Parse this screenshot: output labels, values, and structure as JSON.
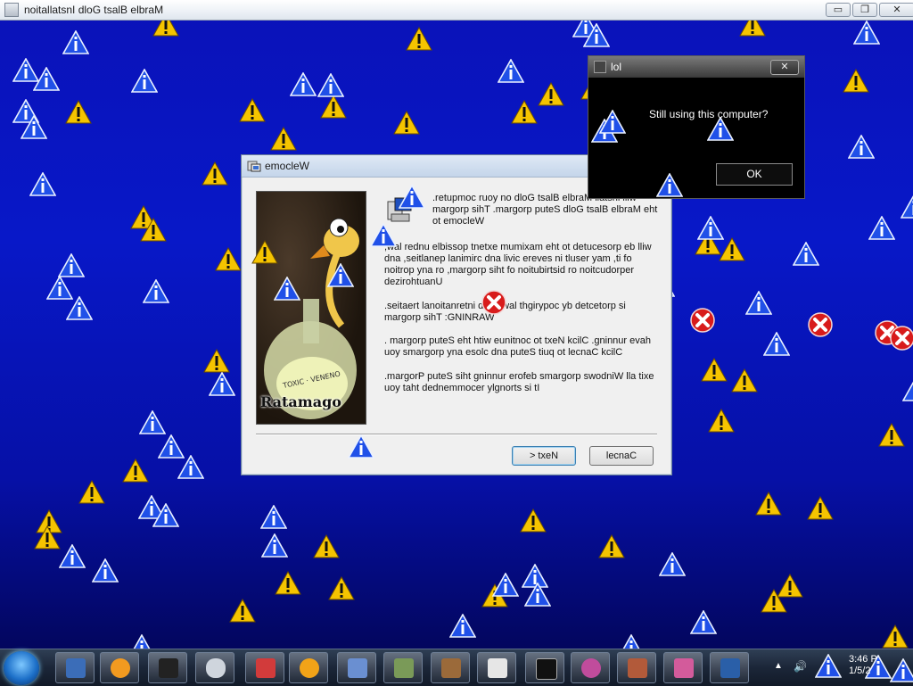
{
  "main_window": {
    "title": "noitallatsnI dloG tsalB elbraM",
    "minimize": "▭",
    "maximize": "❐",
    "close": "✕"
  },
  "wizard": {
    "title": "emocleW",
    "image_brand": "Ratamago",
    "paragraphs": [
      ".retupmoc ruoy no dloG tsalB elbraM llatsni lliw margorp sihT .margorp puteS dloG tsalB elbraM eht ot emocleW",
      ",wal rednu elbissop tnetxe mumixam eht ot detucesorp eb lliw dna ,seitlanep lanimirc dna livic ereves ni tluser yam ,ti fo noitrop yna ro ,margorp siht fo noitubirtsid ro noitcudorper dezirohtuanU",
      ".seitaert lanoitanretni dna swal thgirypoc yb detcetorp si margorp sihT :GNINRAW",
      ". margorp puteS eht htiw eunitnoc ot txeN kcilC .gninnur evah uoy smargorp yna esolc dna puteS tiuq ot lecnaC kcilC",
      ".margorP puteS siht gninnur erofeb smargorp swodniW lla tixe uoy taht dednemmocer ylgnorts si tI"
    ],
    "next_button": "> txeN",
    "cancel_button": "lecnaC"
  },
  "lol_dialog": {
    "title": "lol",
    "message": "Still using this computer?",
    "ok_button": "OK",
    "close": "✕"
  },
  "taskbar": {
    "clock_time": "3:46 P",
    "clock_date": "1/5/2",
    "apps": [
      "windows-explorer",
      "media-player",
      "smartphone-app",
      "mouse-app",
      "paint-app",
      "sun-app",
      "setup-app",
      "setup-app-2",
      "calculator-app",
      "notepad-app",
      "command-prompt",
      "paint-palette",
      "notebook-app",
      "pictures-app",
      "ebook-app"
    ]
  },
  "colors": {
    "desktop_top": "#0a12b8",
    "desktop_bottom": "#02044e",
    "warning_yellow": "#f5c400",
    "info_blue": "#2050e8",
    "error_red": "#d81b1b"
  }
}
